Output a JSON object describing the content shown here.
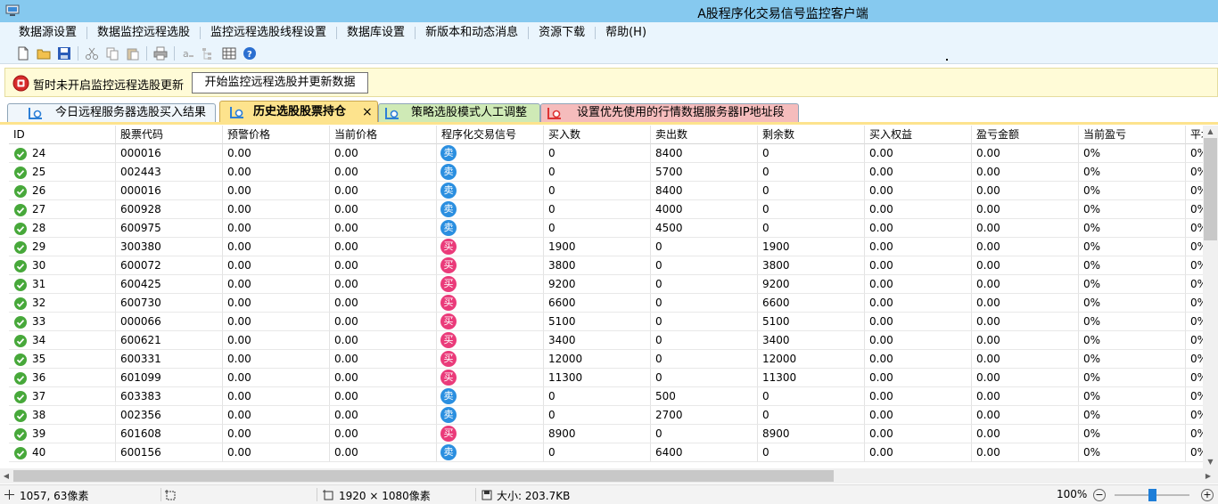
{
  "window": {
    "title": "A股程序化交易信号监控客户端"
  },
  "menu": [
    "数据源设置",
    "数据监控远程选股",
    "监控远程选股线程设置",
    "数据库设置",
    "新版本和动态消息",
    "资源下载",
    "帮助(H)"
  ],
  "toolbar": {
    "icons": [
      "new-icon",
      "open-icon",
      "save-icon",
      "cut-icon",
      "copy-icon",
      "paste-icon",
      "print-icon",
      "font-icon",
      "tree-icon",
      "grid-icon",
      "help-icon"
    ]
  },
  "control": {
    "status": "暂时未开启监控远程选股更新",
    "start_button": "开始监控远程选股并更新数据"
  },
  "tabs": [
    {
      "label": "今日远程服务器选股买入结果"
    },
    {
      "label": "历史选股股票持仓",
      "close": "×"
    },
    {
      "label": "策略选股模式人工调整"
    },
    {
      "label": "设置优先使用的行情数据服务器IP地址段"
    }
  ],
  "colors": {
    "title_bar": "#86c9ef",
    "sell_badge": "#2b8fe0",
    "buy_badge": "#ea3b7a",
    "active_tab": "#fde38d"
  },
  "grid": {
    "columns": [
      "ID",
      "股票代码",
      "预警价格",
      "当前价格",
      "程序化交易信号",
      "买入数",
      "卖出数",
      "剩余数",
      "买入权益",
      "盈亏金额",
      "当前盈亏",
      "平均"
    ],
    "rows": [
      {
        "id": "24",
        "code": "000016",
        "alert": "0.00",
        "price": "0.00",
        "signal": "卖",
        "buy": "0",
        "sell": "8400",
        "remain": "0",
        "equity": "0.00",
        "pnl": "0.00",
        "pct": "0%",
        "avg": "0%"
      },
      {
        "id": "25",
        "code": "002443",
        "alert": "0.00",
        "price": "0.00",
        "signal": "卖",
        "buy": "0",
        "sell": "5700",
        "remain": "0",
        "equity": "0.00",
        "pnl": "0.00",
        "pct": "0%",
        "avg": "0%"
      },
      {
        "id": "26",
        "code": "000016",
        "alert": "0.00",
        "price": "0.00",
        "signal": "卖",
        "buy": "0",
        "sell": "8400",
        "remain": "0",
        "equity": "0.00",
        "pnl": "0.00",
        "pct": "0%",
        "avg": "0%"
      },
      {
        "id": "27",
        "code": "600928",
        "alert": "0.00",
        "price": "0.00",
        "signal": "卖",
        "buy": "0",
        "sell": "4000",
        "remain": "0",
        "equity": "0.00",
        "pnl": "0.00",
        "pct": "0%",
        "avg": "0%"
      },
      {
        "id": "28",
        "code": "600975",
        "alert": "0.00",
        "price": "0.00",
        "signal": "卖",
        "buy": "0",
        "sell": "4500",
        "remain": "0",
        "equity": "0.00",
        "pnl": "0.00",
        "pct": "0%",
        "avg": "0%"
      },
      {
        "id": "29",
        "code": "300380",
        "alert": "0.00",
        "price": "0.00",
        "signal": "买",
        "buy": "1900",
        "sell": "0",
        "remain": "1900",
        "equity": "0.00",
        "pnl": "0.00",
        "pct": "0%",
        "avg": "0%"
      },
      {
        "id": "30",
        "code": "600072",
        "alert": "0.00",
        "price": "0.00",
        "signal": "买",
        "buy": "3800",
        "sell": "0",
        "remain": "3800",
        "equity": "0.00",
        "pnl": "0.00",
        "pct": "0%",
        "avg": "0%"
      },
      {
        "id": "31",
        "code": "600425",
        "alert": "0.00",
        "price": "0.00",
        "signal": "买",
        "buy": "9200",
        "sell": "0",
        "remain": "9200",
        "equity": "0.00",
        "pnl": "0.00",
        "pct": "0%",
        "avg": "0%"
      },
      {
        "id": "32",
        "code": "600730",
        "alert": "0.00",
        "price": "0.00",
        "signal": "买",
        "buy": "6600",
        "sell": "0",
        "remain": "6600",
        "equity": "0.00",
        "pnl": "0.00",
        "pct": "0%",
        "avg": "0%"
      },
      {
        "id": "33",
        "code": "000066",
        "alert": "0.00",
        "price": "0.00",
        "signal": "买",
        "buy": "5100",
        "sell": "0",
        "remain": "5100",
        "equity": "0.00",
        "pnl": "0.00",
        "pct": "0%",
        "avg": "0%"
      },
      {
        "id": "34",
        "code": "600621",
        "alert": "0.00",
        "price": "0.00",
        "signal": "买",
        "buy": "3400",
        "sell": "0",
        "remain": "3400",
        "equity": "0.00",
        "pnl": "0.00",
        "pct": "0%",
        "avg": "0%"
      },
      {
        "id": "35",
        "code": "600331",
        "alert": "0.00",
        "price": "0.00",
        "signal": "买",
        "buy": "12000",
        "sell": "0",
        "remain": "12000",
        "equity": "0.00",
        "pnl": "0.00",
        "pct": "0%",
        "avg": "0%"
      },
      {
        "id": "36",
        "code": "601099",
        "alert": "0.00",
        "price": "0.00",
        "signal": "买",
        "buy": "11300",
        "sell": "0",
        "remain": "11300",
        "equity": "0.00",
        "pnl": "0.00",
        "pct": "0%",
        "avg": "0%"
      },
      {
        "id": "37",
        "code": "603383",
        "alert": "0.00",
        "price": "0.00",
        "signal": "卖",
        "buy": "0",
        "sell": "500",
        "remain": "0",
        "equity": "0.00",
        "pnl": "0.00",
        "pct": "0%",
        "avg": "0%"
      },
      {
        "id": "38",
        "code": "002356",
        "alert": "0.00",
        "price": "0.00",
        "signal": "卖",
        "buy": "0",
        "sell": "2700",
        "remain": "0",
        "equity": "0.00",
        "pnl": "0.00",
        "pct": "0%",
        "avg": "0%"
      },
      {
        "id": "39",
        "code": "601608",
        "alert": "0.00",
        "price": "0.00",
        "signal": "买",
        "buy": "8900",
        "sell": "0",
        "remain": "8900",
        "equity": "0.00",
        "pnl": "0.00",
        "pct": "0%",
        "avg": "0%"
      },
      {
        "id": "40",
        "code": "600156",
        "alert": "0.00",
        "price": "0.00",
        "signal": "卖",
        "buy": "0",
        "sell": "6400",
        "remain": "0",
        "equity": "0.00",
        "pnl": "0.00",
        "pct": "0%",
        "avg": "0%"
      }
    ]
  },
  "statusbar": {
    "cursor": "1057, 63像素",
    "dimensions": "1920 × 1080像素",
    "filesize": "大小: 203.7KB",
    "zoom": "100%",
    "zoom_out": "−",
    "zoom_in": "+"
  }
}
